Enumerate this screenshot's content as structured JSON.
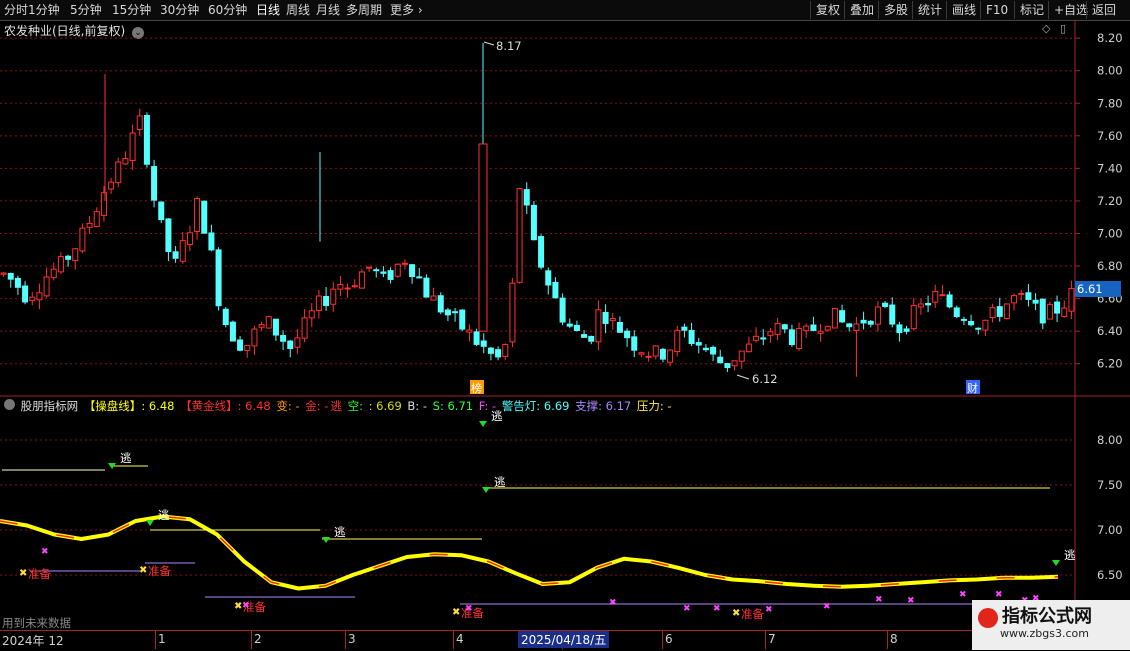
{
  "toolbar": {
    "periods": [
      "分时",
      "1分钟",
      "5分钟",
      "15分钟",
      "30分钟",
      "60分钟",
      "日线",
      "周线",
      "月线",
      "多周期",
      "更多"
    ],
    "active_period": "日线",
    "right_buttons": [
      "复权",
      "叠加",
      "多股",
      "统计",
      "画线",
      "F10",
      "标记",
      "+自选",
      "返回"
    ]
  },
  "main_chart": {
    "title": "农发种业(日线,前复权)",
    "price_axis": [
      "8.20",
      "8.00",
      "7.80",
      "7.60",
      "7.40",
      "7.20",
      "7.00",
      "6.80",
      "6.60",
      "6.40",
      "6.20"
    ],
    "current_price": "6.61",
    "high_label": "8.17",
    "low_label": "6.12",
    "markers": {
      "bang": "榜",
      "cai": "财"
    }
  },
  "indicator": {
    "name": "股朋指标网",
    "caopan_label": "【操盘线】",
    "caopan_value": ": 6.48",
    "huangjin_label": "【黄金线】",
    "huangjin_value": ": 6.48",
    "bian": "变: -",
    "jin": "金: -",
    "tao": "逃",
    "kong": "空: ",
    "kong_value": ": 6.69",
    "b": "B: -",
    "s": "S: 6.71",
    "f": "F: -",
    "jinggao": "警告灯: 6.69",
    "zhicheng": "支撑: 6.17",
    "yali": "压力: -",
    "axis": [
      "8.00",
      "7.50",
      "7.00",
      "6.50"
    ],
    "signal_escape": "逃",
    "signal_prepare": "准备"
  },
  "x_axis": {
    "labels": [
      "2024年 12",
      "1",
      "2",
      "3",
      "4",
      "5",
      "6",
      "7",
      "8"
    ],
    "highlight_date": "2025/04/18/五"
  },
  "footer_note": "用到未来数据",
  "watermark": {
    "title": "指标公式网",
    "url": "www.zbgs3.com"
  },
  "colors": {
    "up": "#ff3030",
    "down": "#54ffff",
    "caopan": "#ffff00",
    "huangjin": "#ff2020",
    "grid": "#8a1010"
  },
  "chart_data": [
    {
      "type": "candlestick",
      "title": "农发种业(日线,前复权)",
      "y_range": [
        6.1,
        8.25
      ],
      "annotations": {
        "max": 8.17,
        "min": 6.12,
        "last": 6.61
      }
    },
    {
      "type": "line",
      "title": "股朋指标网",
      "y_range": [
        6.25,
        8.2
      ],
      "series": [
        {
          "name": "操盘线",
          "values": [
            7.1,
            7.05,
            6.95,
            6.9,
            6.95,
            7.1,
            7.15,
            7.12,
            6.95,
            6.65,
            6.42,
            6.35,
            6.38,
            6.5,
            6.6,
            6.7,
            6.73,
            6.72,
            6.65,
            6.52,
            6.4,
            6.42,
            6.58,
            6.68,
            6.65,
            6.58,
            6.5,
            6.45,
            6.43,
            6.4,
            6.38,
            6.37,
            6.38,
            6.4,
            6.42,
            6.44,
            6.45,
            6.47,
            6.47,
            6.48
          ]
        }
      ]
    }
  ]
}
